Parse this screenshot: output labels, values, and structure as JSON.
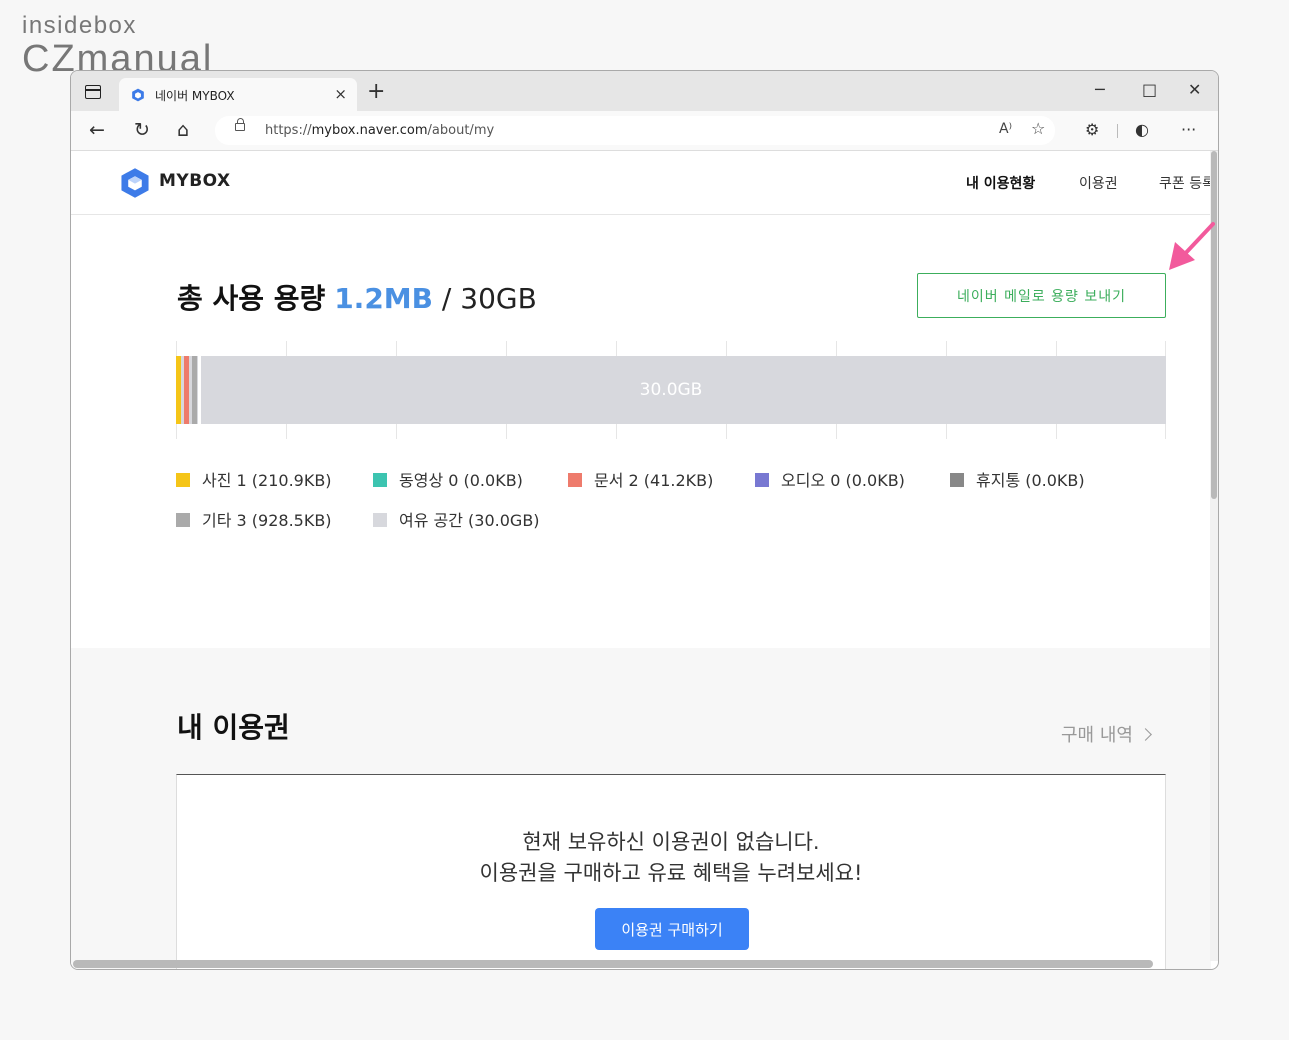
{
  "watermark": {
    "line1": "insidebox",
    "line2": "CZmanual"
  },
  "browser": {
    "tab_title": "네이버 MYBOX",
    "tab_close": "×",
    "new_tab": "+",
    "win_min": "─",
    "win_max": "□",
    "win_close": "✕",
    "url_scheme": "https://",
    "url_domain": "mybox.naver.com",
    "url_path": "/about/my",
    "read_aloud": "A⁾",
    "more": "···"
  },
  "site": {
    "brand": "MYBOX",
    "nav": [
      "내 이용현황",
      "이용권",
      "쿠폰 등록"
    ]
  },
  "usage": {
    "title_prefix": "총 사용 용량",
    "used": "1.2MB",
    "slash": "/",
    "total": "30GB",
    "send_button": "네이버 메일로 용량 보내기",
    "bar_label": "30.0GB",
    "bar_segments": [
      {
        "name": "사진",
        "fraction": 0.006,
        "color": "#f5c518"
      },
      {
        "name": "문서",
        "fraction": 0.006,
        "color": "#ee7b6c"
      },
      {
        "name": "기타",
        "fraction": 0.006,
        "color": "#aaaaaa"
      }
    ],
    "legend": [
      {
        "label": "사진 1 (210.9KB)",
        "color": "#f5c518"
      },
      {
        "label": "동영상 0 (0.0KB)",
        "color": "#3cc4b0"
      },
      {
        "label": "문서 2 (41.2KB)",
        "color": "#ee7b6c"
      },
      {
        "label": "오디오 0 (0.0KB)",
        "color": "#7878d2"
      },
      {
        "label": "휴지통 (0.0KB)",
        "color": "#888888"
      },
      {
        "label": "기타 3 (928.5KB)",
        "color": "#aaaaaa"
      },
      {
        "label": "여유 공간 (30.0GB)",
        "color": "#d7d8dd"
      }
    ]
  },
  "tickets": {
    "title": "내 이용권",
    "history_link": "구매 내역",
    "empty_line1": "현재 보유하신 이용권이 없습니다.",
    "empty_line2": "이용권을 구매하고 유료 혜택을 누려보세요!",
    "buy_button": "이용권 구매하기"
  },
  "colors": {
    "accent_blue": "#4a90e2",
    "green": "#3cae5c",
    "button_blue": "#3b82f6",
    "arrow_pink": "#f25a9c"
  }
}
